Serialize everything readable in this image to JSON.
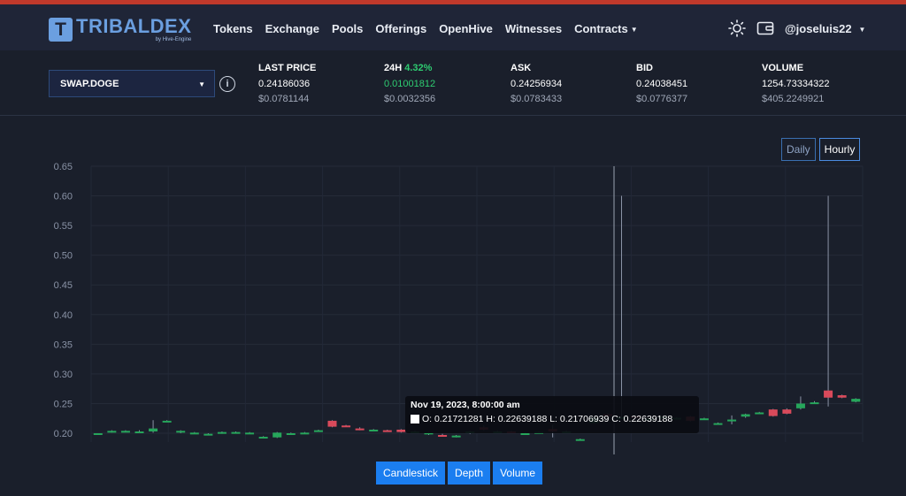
{
  "brand": {
    "name": "TRIBALDEX",
    "sub": "by Hive-Engine",
    "letter": "T"
  },
  "nav": {
    "links": [
      "Tokens",
      "Exchange",
      "Pools",
      "Offerings",
      "OpenHive",
      "Witnesses",
      "Contracts"
    ],
    "user": "@joseluis22"
  },
  "ticker": {
    "symbol": "SWAP.DOGE",
    "last_price": {
      "label": "LAST PRICE",
      "value": "0.24186036",
      "usd": "$0.0781144"
    },
    "change": {
      "label": "24H",
      "pct": "4.32%",
      "value": "0.01001812",
      "usd": "$0.0032356"
    },
    "ask": {
      "label": "ASK",
      "value": "0.24256934",
      "usd": "$0.0783433"
    },
    "bid": {
      "label": "BID",
      "value": "0.24038451",
      "usd": "$0.0776377"
    },
    "volume": {
      "label": "VOLUME",
      "value": "1254.73334322",
      "usd": "$405.2249921"
    }
  },
  "range": {
    "daily": "Daily",
    "hourly": "Hourly",
    "selected": "Hourly"
  },
  "tabs": {
    "candlestick": "Candlestick",
    "depth": "Depth",
    "volume": "Volume"
  },
  "tooltip": {
    "date": "Nov 19, 2023, 8:00:00 am",
    "ohlc": "O: 0.21721281  H: 0.22639188  L: 0.21706939  C: 0.22639188"
  },
  "colors": {
    "up": "#26a65b",
    "down": "#d94a5b",
    "accent": "#1b7ef0",
    "bg": "#1a1f2b"
  },
  "chart_data": {
    "type": "candlestick",
    "y_ticks": [
      "0.65",
      "0.60",
      "0.55",
      "0.50",
      "0.45",
      "0.40",
      "0.35",
      "0.30",
      "0.25",
      "0.20"
    ],
    "ylim": [
      0.195,
      0.65
    ],
    "grid": true,
    "candles": [
      {
        "o": 0.199,
        "h": 0.2,
        "l": 0.198,
        "c": 0.2
      },
      {
        "o": 0.203,
        "h": 0.205,
        "l": 0.201,
        "c": 0.204
      },
      {
        "o": 0.204,
        "h": 0.205,
        "l": 0.203,
        "c": 0.204
      },
      {
        "o": 0.203,
        "h": 0.205,
        "l": 0.202,
        "c": 0.203
      },
      {
        "o": 0.203,
        "h": 0.222,
        "l": 0.201,
        "c": 0.208
      },
      {
        "o": 0.221,
        "h": 0.222,
        "l": 0.22,
        "c": 0.221
      },
      {
        "o": 0.202,
        "h": 0.205,
        "l": 0.2,
        "c": 0.204
      },
      {
        "o": 0.201,
        "h": 0.202,
        "l": 0.2,
        "c": 0.201
      },
      {
        "o": 0.199,
        "h": 0.2,
        "l": 0.197,
        "c": 0.199
      },
      {
        "o": 0.2,
        "h": 0.203,
        "l": 0.199,
        "c": 0.202
      },
      {
        "o": 0.202,
        "h": 0.203,
        "l": 0.201,
        "c": 0.202
      },
      {
        "o": 0.201,
        "h": 0.202,
        "l": 0.2,
        "c": 0.201
      },
      {
        "o": 0.194,
        "h": 0.195,
        "l": 0.193,
        "c": 0.194
      },
      {
        "o": 0.193,
        "h": 0.202,
        "l": 0.192,
        "c": 0.201
      },
      {
        "o": 0.2,
        "h": 0.201,
        "l": 0.199,
        "c": 0.2
      },
      {
        "o": 0.2,
        "h": 0.202,
        "l": 0.199,
        "c": 0.201
      },
      {
        "o": 0.204,
        "h": 0.206,
        "l": 0.203,
        "c": 0.205
      },
      {
        "o": 0.221,
        "h": 0.222,
        "l": 0.21,
        "c": 0.211
      },
      {
        "o": 0.213,
        "h": 0.214,
        "l": 0.211,
        "c": 0.212
      },
      {
        "o": 0.208,
        "h": 0.21,
        "l": 0.205,
        "c": 0.206
      },
      {
        "o": 0.206,
        "h": 0.207,
        "l": 0.205,
        "c": 0.206
      },
      {
        "o": 0.205,
        "h": 0.206,
        "l": 0.203,
        "c": 0.204
      },
      {
        "o": 0.206,
        "h": 0.207,
        "l": 0.201,
        "c": 0.202
      },
      {
        "o": 0.203,
        "h": 0.204,
        "l": 0.202,
        "c": 0.203
      },
      {
        "o": 0.198,
        "h": 0.202,
        "l": 0.197,
        "c": 0.201
      },
      {
        "o": 0.197,
        "h": 0.199,
        "l": 0.195,
        "c": 0.196
      },
      {
        "o": 0.194,
        "h": 0.197,
        "l": 0.193,
        "c": 0.196
      },
      {
        "o": 0.2,
        "h": 0.204,
        "l": 0.199,
        "c": 0.203
      },
      {
        "o": 0.21,
        "h": 0.213,
        "l": 0.205,
        "c": 0.206
      },
      {
        "o": 0.203,
        "h": 0.204,
        "l": 0.202,
        "c": 0.203
      },
      {
        "o": 0.203,
        "h": 0.204,
        "l": 0.2,
        "c": 0.201
      },
      {
        "o": 0.199,
        "h": 0.201,
        "l": 0.197,
        "c": 0.2
      },
      {
        "o": 0.202,
        "h": 0.203,
        "l": 0.201,
        "c": 0.202
      },
      {
        "o": 0.207,
        "h": 0.214,
        "l": 0.193,
        "c": 0.203
      },
      {
        "o": 0.203,
        "h": 0.204,
        "l": 0.202,
        "c": 0.203
      },
      {
        "o": 0.19,
        "h": 0.191,
        "l": 0.189,
        "c": 0.19
      },
      {
        "o": 0.2172,
        "h": 0.2264,
        "l": 0.2171,
        "c": 0.2264
      },
      {
        "o": 0.232,
        "h": 0.234,
        "l": 0.23,
        "c": 0.231
      },
      {
        "o": 0.226,
        "h": 0.6,
        "l": 0.225,
        "c": 0.227
      },
      {
        "o": 0.229,
        "h": 0.231,
        "l": 0.227,
        "c": 0.228
      },
      {
        "o": 0.225,
        "h": 0.226,
        "l": 0.224,
        "c": 0.225
      },
      {
        "o": 0.227,
        "h": 0.229,
        "l": 0.226,
        "c": 0.228
      },
      {
        "o": 0.226,
        "h": 0.227,
        "l": 0.225,
        "c": 0.226
      },
      {
        "o": 0.228,
        "h": 0.229,
        "l": 0.22,
        "c": 0.221
      },
      {
        "o": 0.225,
        "h": 0.226,
        "l": 0.224,
        "c": 0.225
      },
      {
        "o": 0.217,
        "h": 0.218,
        "l": 0.216,
        "c": 0.217
      },
      {
        "o": 0.22,
        "h": 0.23,
        "l": 0.215,
        "c": 0.223
      },
      {
        "o": 0.228,
        "h": 0.233,
        "l": 0.226,
        "c": 0.232
      },
      {
        "o": 0.234,
        "h": 0.236,
        "l": 0.233,
        "c": 0.235
      },
      {
        "o": 0.24,
        "h": 0.241,
        "l": 0.228,
        "c": 0.229
      },
      {
        "o": 0.24,
        "h": 0.242,
        "l": 0.232,
        "c": 0.233
      },
      {
        "o": 0.242,
        "h": 0.262,
        "l": 0.24,
        "c": 0.25
      },
      {
        "o": 0.252,
        "h": 0.254,
        "l": 0.251,
        "c": 0.252
      },
      {
        "o": 0.272,
        "h": 0.6,
        "l": 0.245,
        "c": 0.26
      },
      {
        "o": 0.264,
        "h": 0.265,
        "l": 0.259,
        "c": 0.26
      },
      {
        "o": 0.253,
        "h": 0.259,
        "l": 0.252,
        "c": 0.258
      }
    ]
  }
}
